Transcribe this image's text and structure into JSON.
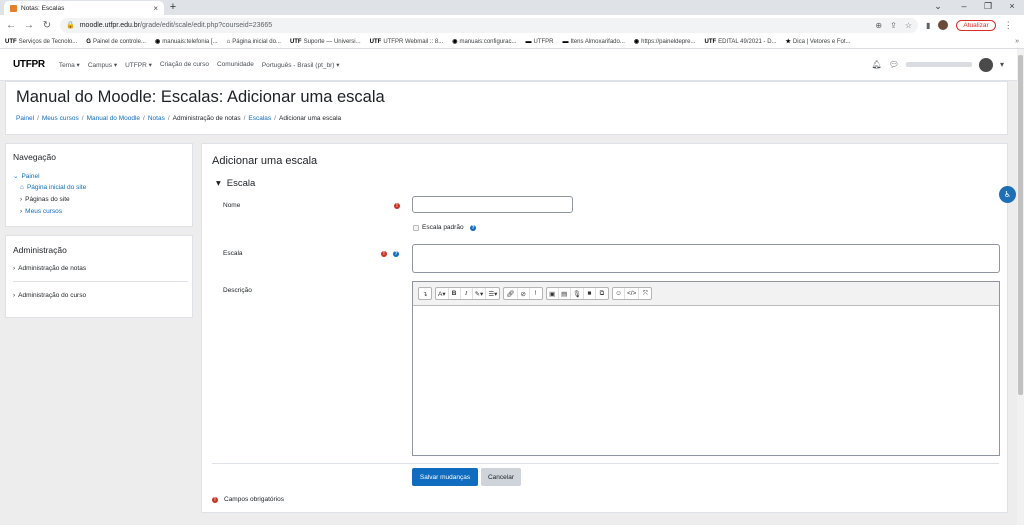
{
  "browser": {
    "tab_title": "Notas: Escalas",
    "url_host": "moodle.utfpr.edu.br",
    "url_path": "/grade/edit/scale/edit.php?courseid=23665",
    "update_label": "Atualizar",
    "bookmarks": [
      {
        "icon": "UTF",
        "label": "Serviços de Tecnolo..."
      },
      {
        "icon": "G",
        "label": "Painel de controle..."
      },
      {
        "icon": "◉",
        "label": "manuais:telefonia [..."
      },
      {
        "icon": "⌂",
        "label": "Página inicial do..."
      },
      {
        "icon": "UTF",
        "label": "Suporte — Universi..."
      },
      {
        "icon": "UTF",
        "label": "UTFPR Webmail :: 8..."
      },
      {
        "icon": "◉",
        "label": "manuais:configurac..."
      },
      {
        "icon": "▬",
        "label": "UTFPR"
      },
      {
        "icon": "▬",
        "label": "Itens Almoxarifado..."
      },
      {
        "icon": "◉",
        "label": "https://paineldepre..."
      },
      {
        "icon": "UTF",
        "label": "EDITAL 49/2021 - D..."
      },
      {
        "icon": "★",
        "label": "Dica | Vetores e Fot..."
      }
    ]
  },
  "moodle_nav": {
    "logo": "UTFPR",
    "items": [
      "Tema ▾",
      "Campus ▾",
      "UTFPR ▾",
      "Criação de curso",
      "Comunidade",
      "Português - Brasil (pt_br) ▾"
    ]
  },
  "header": {
    "title": "Manual do Moodle: Escalas: Adicionar uma escala",
    "breadcrumb": [
      {
        "label": "Painel",
        "link": true
      },
      {
        "label": "Meus cursos",
        "link": true
      },
      {
        "label": "Manual do Moodle",
        "link": true
      },
      {
        "label": "Notas",
        "link": true
      },
      {
        "label": "Administração de notas",
        "link": false
      },
      {
        "label": "Escalas",
        "link": true
      },
      {
        "label": "Adicionar uma escala",
        "link": false
      }
    ]
  },
  "navigation_block": {
    "title": "Navegação",
    "painel": "Painel",
    "home": "Página inicial do site",
    "pages": "Páginas do site",
    "my_courses": "Meus cursos"
  },
  "admin_block": {
    "title": "Administração",
    "grades_admin": "Administração de notas",
    "course_admin": "Administração do curso"
  },
  "form": {
    "title": "Adicionar uma escala",
    "legend": "Escala",
    "name_label": "Nome",
    "name_value": "",
    "standard_scale_label": "Escala padrão",
    "scale_label": "Escala",
    "scale_value": "",
    "description_label": "Descrição",
    "save_label": "Salvar mudanças",
    "cancel_label": "Cancelar",
    "required_note": "Campos obrigatórios"
  },
  "colors": {
    "primary": "#0f6cbf",
    "required": "#ca3120",
    "update": "#d93025"
  }
}
